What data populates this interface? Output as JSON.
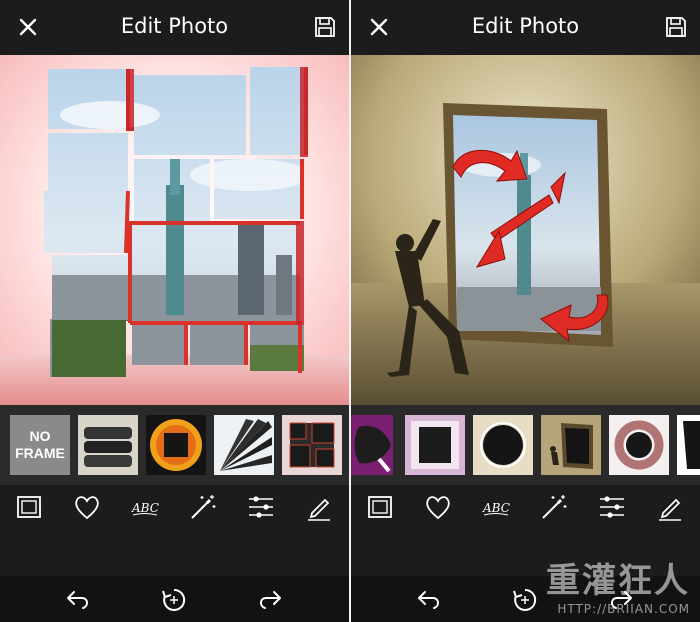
{
  "left_screen": {
    "header": {
      "title": "Edit Photo"
    },
    "frames": [
      {
        "label": "NO FRAME",
        "icon": "no-frame"
      },
      {
        "label": "",
        "icon": "film-stack-frame"
      },
      {
        "label": "",
        "icon": "sunflower-frame"
      },
      {
        "label": "",
        "icon": "fan-frame"
      },
      {
        "label": "",
        "icon": "block-puzzle-frame"
      }
    ]
  },
  "right_screen": {
    "header": {
      "title": "Edit Photo"
    },
    "frames": [
      {
        "icon": "paint-brush-frame"
      },
      {
        "icon": "torn-paper-frame"
      },
      {
        "icon": "circle-frame"
      },
      {
        "icon": "man-pushing-frame"
      },
      {
        "icon": "brush-circle-frame"
      },
      {
        "icon": "partial-frame"
      }
    ]
  },
  "tools": [
    "frame-tool-icon",
    "sticker-heart-icon",
    "text-abc-icon",
    "magic-wand-icon",
    "adjust-sliders-icon",
    "edit-pencil-icon"
  ],
  "watermark": {
    "title": "重灌狂人",
    "url": "HTTP://BRIIAN.COM"
  },
  "colors": {
    "toolbar_bg": "#1c1c1c",
    "strip_bg": "#2a2a2a",
    "accent_red": "#e02b24",
    "icon": "#ffffff"
  }
}
